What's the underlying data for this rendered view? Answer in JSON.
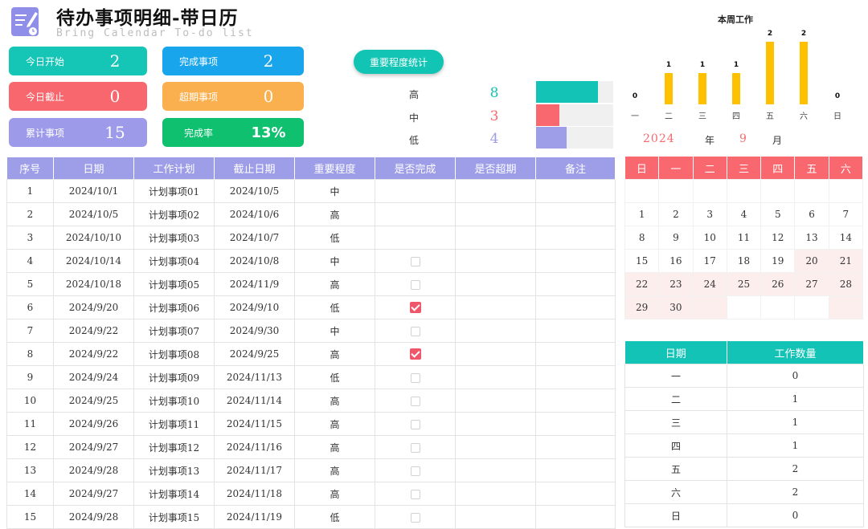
{
  "header": {
    "title": "待办事项明细-带日历",
    "subtitle": "Bring Calendar To-do list"
  },
  "stats": [
    {
      "label": "今日开始",
      "value": "2",
      "color": "#15c6b7"
    },
    {
      "label": "今日截止",
      "value": "0",
      "color": "#f8676d"
    },
    {
      "label": "累计事项",
      "value": "15",
      "color": "#9d9be9"
    },
    {
      "label": "完成事项",
      "value": "2",
      "color": "#18a5ec"
    },
    {
      "label": "超期事项",
      "value": "0",
      "color": "#fbb04f"
    },
    {
      "label": "完成率",
      "value": "13%",
      "color": "#0fc06f"
    }
  ],
  "importance": {
    "button_label": "重要程度统计",
    "rows": [
      {
        "label": "高",
        "value": "8",
        "color": "#13c3b5",
        "fill": 0.8
      },
      {
        "label": "中",
        "value": "3",
        "color": "#f8686e",
        "fill": 0.3
      },
      {
        "label": "低",
        "value": "4",
        "color": "#9e9de8",
        "fill": 0.4
      }
    ]
  },
  "week_chart": {
    "title": "本周工作",
    "chart_data": {
      "type": "bar",
      "categories": [
        "一",
        "二",
        "三",
        "四",
        "五",
        "六",
        "日"
      ],
      "values": [
        0,
        1,
        1,
        1,
        2,
        2,
        0
      ],
      "title": "本周工作",
      "ylim": [
        0,
        2
      ],
      "color": "#ffc000"
    }
  },
  "calendar": {
    "year": "2024",
    "year_label": "年",
    "month": "9",
    "month_label": "月",
    "weekdays": [
      "日",
      "一",
      "二",
      "三",
      "四",
      "五",
      "六"
    ],
    "weeks": [
      [
        "",
        "",
        "",
        "",
        "",
        "",
        ""
      ],
      [
        "1",
        "2",
        "3",
        "4",
        "5",
        "6",
        "7"
      ],
      [
        "8",
        "9",
        "10",
        "11",
        "12",
        "13",
        "14"
      ],
      [
        "15",
        "16",
        "17",
        "18",
        "19",
        "20",
        "21"
      ],
      [
        "22",
        "23",
        "24",
        "25",
        "26",
        "27",
        "28"
      ],
      [
        "29",
        "30",
        "",
        "",
        "",
        "",
        ""
      ]
    ]
  },
  "work_count": {
    "headers": [
      "日期",
      "工作数量"
    ],
    "rows": [
      [
        "一",
        "0"
      ],
      [
        "二",
        "1"
      ],
      [
        "三",
        "1"
      ],
      [
        "四",
        "1"
      ],
      [
        "五",
        "2"
      ],
      [
        "六",
        "2"
      ],
      [
        "日",
        "0"
      ]
    ]
  },
  "task_table": {
    "headers": [
      "序号",
      "日期",
      "工作计划",
      "截止日期",
      "重要程度",
      "是否完成",
      "是否超期",
      "备注"
    ],
    "rows": [
      {
        "no": "1",
        "date": "2024/10/1",
        "plan": "计划事项01",
        "due": "2024/10/5",
        "priority": "中",
        "done": null
      },
      {
        "no": "2",
        "date": "2024/10/5",
        "plan": "计划事项02",
        "due": "2024/10/6",
        "priority": "高",
        "done": null
      },
      {
        "no": "3",
        "date": "2024/10/10",
        "plan": "计划事项03",
        "due": "2024/10/7",
        "priority": "低",
        "done": null
      },
      {
        "no": "4",
        "date": "2024/10/14",
        "plan": "计划事项04",
        "due": "2024/10/8",
        "priority": "中",
        "done": false
      },
      {
        "no": "5",
        "date": "2024/10/18",
        "plan": "计划事项05",
        "due": "2024/11/9",
        "priority": "高",
        "done": false
      },
      {
        "no": "6",
        "date": "2024/9/20",
        "plan": "计划事项06",
        "due": "2024/9/10",
        "priority": "低",
        "done": true
      },
      {
        "no": "7",
        "date": "2024/9/22",
        "plan": "计划事项07",
        "due": "2024/9/30",
        "priority": "中",
        "done": false
      },
      {
        "no": "8",
        "date": "2024/9/22",
        "plan": "计划事项08",
        "due": "2024/9/25",
        "priority": "高",
        "done": true
      },
      {
        "no": "9",
        "date": "2024/9/24",
        "plan": "计划事项09",
        "due": "2024/11/13",
        "priority": "低",
        "done": false
      },
      {
        "no": "10",
        "date": "2024/9/25",
        "plan": "计划事项10",
        "due": "2024/11/14",
        "priority": "高",
        "done": false
      },
      {
        "no": "11",
        "date": "2024/9/26",
        "plan": "计划事项11",
        "due": "2024/11/15",
        "priority": "高",
        "done": false
      },
      {
        "no": "12",
        "date": "2024/9/27",
        "plan": "计划事项12",
        "due": "2024/11/16",
        "priority": "高",
        "done": false
      },
      {
        "no": "13",
        "date": "2024/9/28",
        "plan": "计划事项13",
        "due": "2024/11/17",
        "priority": "高",
        "done": false
      },
      {
        "no": "14",
        "date": "2024/9/27",
        "plan": "计划事项14",
        "due": "2024/11/18",
        "priority": "高",
        "done": false
      },
      {
        "no": "15",
        "date": "2024/9/28",
        "plan": "计划事项15",
        "due": "2024/11/19",
        "priority": "低",
        "done": false
      }
    ]
  }
}
